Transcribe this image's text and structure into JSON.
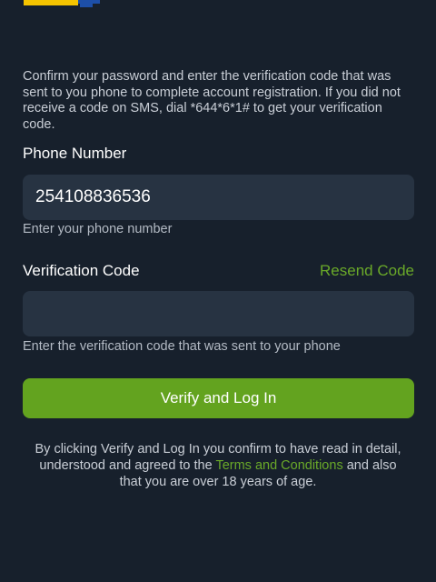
{
  "colors": {
    "background": "#17202c",
    "input_background": "#273342",
    "accent_green": "#63a31f",
    "link_green": "#6aa929"
  },
  "logo": {
    "icon": "brand-logo-icon"
  },
  "intro_text": "Confirm your password and enter the verification code that was sent to you phone to complete account registration. If you did not receive a code on SMS, dial *644*6*1# to get your verification code.",
  "phone": {
    "label": "Phone Number",
    "value": "254108836536",
    "hint": "Enter your phone number"
  },
  "verification": {
    "label": "Verification Code",
    "resend_label": "Resend Code",
    "value": "",
    "hint": "Enter the verification code that was sent to your phone"
  },
  "verify_button": {
    "label": "Verify and Log In"
  },
  "disclaimer": {
    "before_link": "By clicking Verify and Log In you confirm to have read in detail, understood and agreed to the ",
    "link_text": "Terms and Conditions",
    "after_link": " and also that you are over 18 years of age."
  }
}
